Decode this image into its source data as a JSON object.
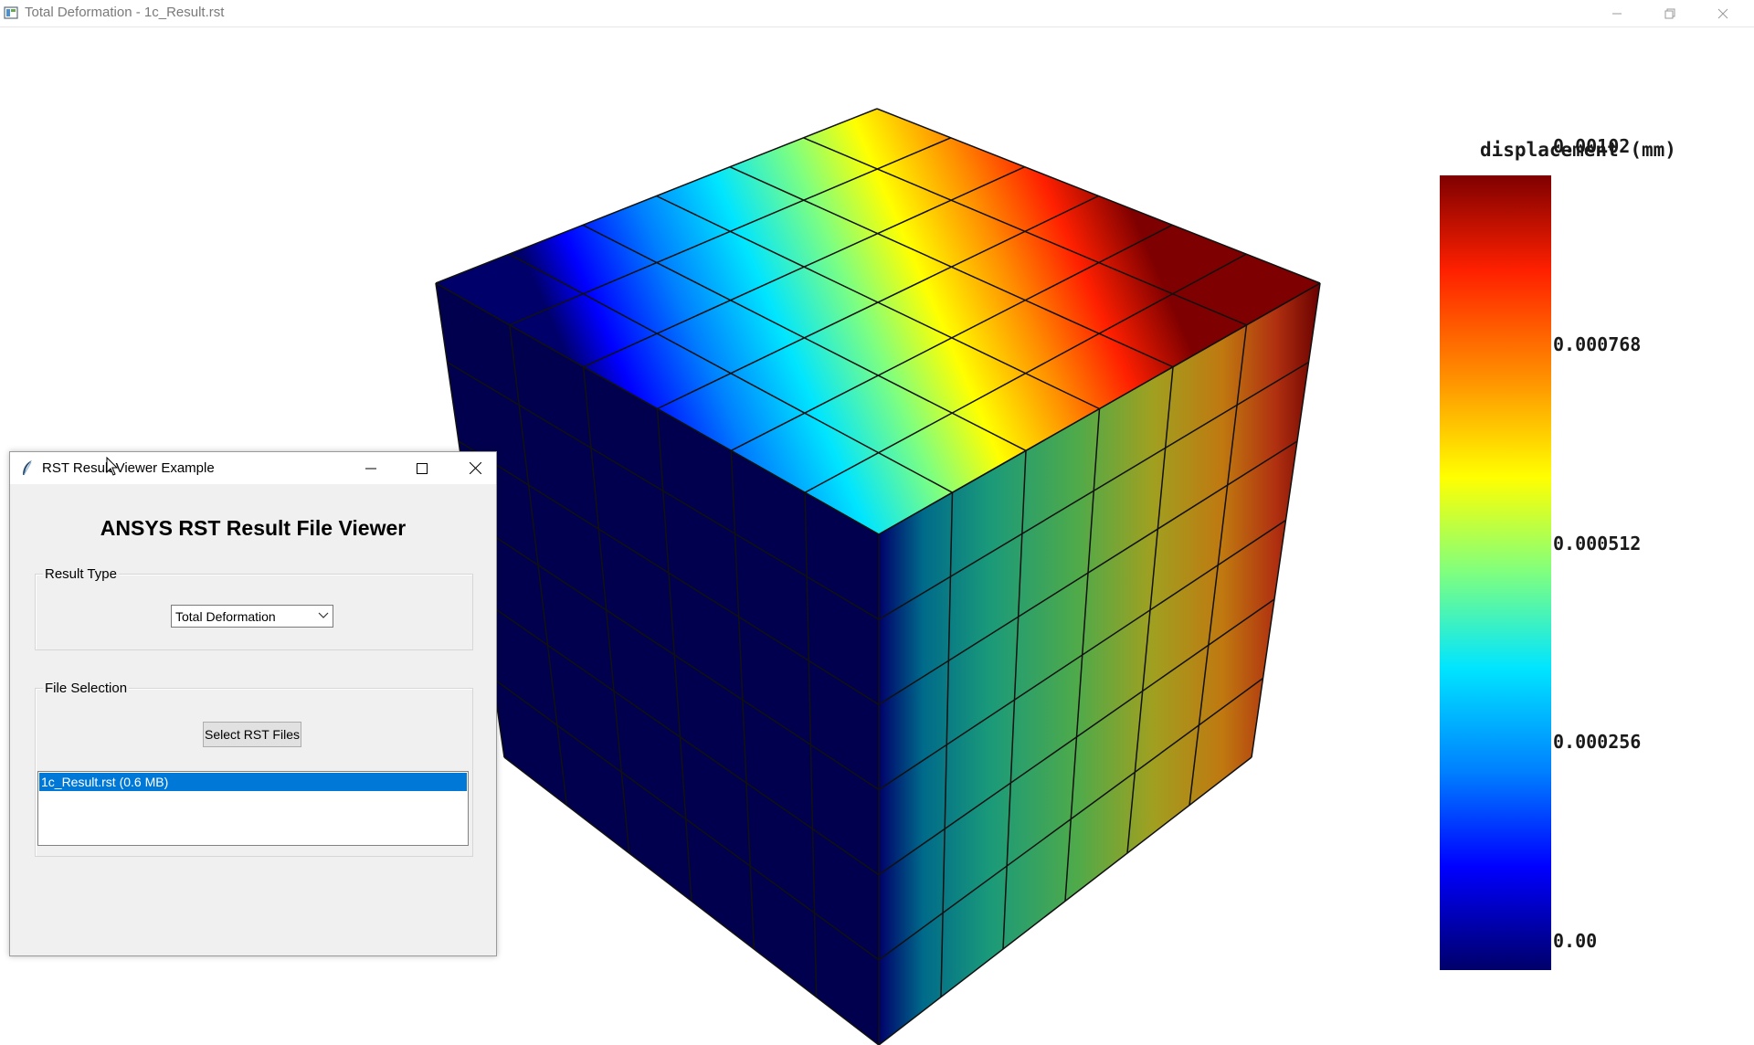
{
  "window": {
    "title": "Total Deformation - 1c_Result.rst",
    "icon": "app-window-icon",
    "controls": [
      "minimize-icon",
      "restore-icon",
      "close-icon"
    ]
  },
  "colorbar": {
    "title": "displacement (mm)",
    "ticks": [
      "0.00102",
      "0.000768",
      "0.000512",
      "0.000256",
      "0.00"
    ],
    "colormap": "jet",
    "min": 0.0,
    "max": 0.00102
  },
  "dialog": {
    "title": "RST Result Viewer Example",
    "icon": "feather-icon",
    "heading": "ANSYS RST Result File Viewer",
    "result_type": {
      "label": "Result Type",
      "selected": "Total Deformation"
    },
    "file_selection": {
      "label": "File Selection",
      "button_label": "Select RST Files",
      "files": [
        "1c_Result.rst (0.6 MB)"
      ]
    }
  },
  "colors": {
    "jet_low": "#00006a",
    "jet_high": "#7f0000",
    "selection": "#0078d7"
  }
}
